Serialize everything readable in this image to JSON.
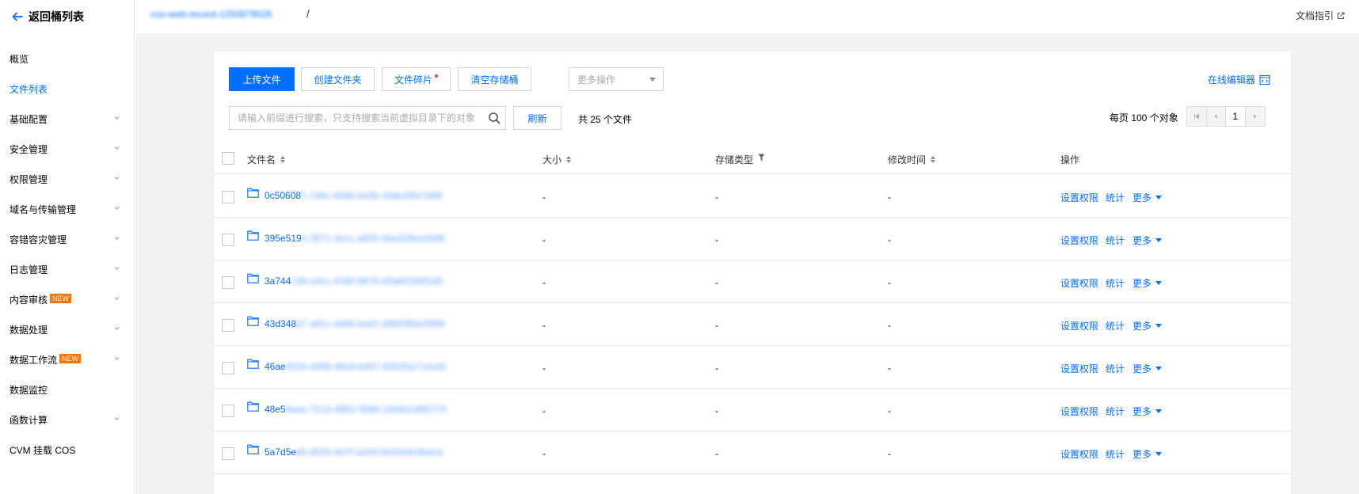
{
  "sidebar": {
    "back_label": "返回桶列表",
    "items": [
      {
        "label": "概览",
        "active": false,
        "expandable": false
      },
      {
        "label": "文件列表",
        "active": true,
        "expandable": false
      },
      {
        "label": "基础配置",
        "active": false,
        "expandable": true
      },
      {
        "label": "安全管理",
        "active": false,
        "expandable": true
      },
      {
        "label": "权限管理",
        "active": false,
        "expandable": true
      },
      {
        "label": "域名与传输管理",
        "active": false,
        "expandable": true
      },
      {
        "label": "容错容灾管理",
        "active": false,
        "expandable": true
      },
      {
        "label": "日志管理",
        "active": false,
        "expandable": true
      },
      {
        "label": "内容审核",
        "active": false,
        "expandable": true,
        "badge": "NEW"
      },
      {
        "label": "数据处理",
        "active": false,
        "expandable": true
      },
      {
        "label": "数据工作流",
        "active": false,
        "expandable": true,
        "badge": "NEW"
      },
      {
        "label": "数据监控",
        "active": false,
        "expandable": false
      },
      {
        "label": "函数计算",
        "active": false,
        "expandable": true
      },
      {
        "label": "CVM 挂载 COS",
        "active": false,
        "expandable": false
      }
    ]
  },
  "topbar": {
    "bucket_name": "cos-web-record-1250879026",
    "separator": "/",
    "doc_guide": "文档指引"
  },
  "toolbar": {
    "upload": "上传文件",
    "create_folder": "创建文件夹",
    "fragments": "文件碎片",
    "clear_bucket": "清空存储桶",
    "more_ops": "更多操作",
    "online_editor": "在线编辑器",
    "search_placeholder": "请输入前缀进行搜索，只支持搜索当前虚拟目录下的对象",
    "refresh": "刷新",
    "total": "共 25 个文件",
    "per_page": "每页 100 个对象",
    "page": "1"
  },
  "table": {
    "headers": {
      "name": "文件名",
      "size": "大小",
      "storage": "存储类型",
      "modified": "修改时间",
      "actions": "操作"
    },
    "action_labels": {
      "perm": "设置权限",
      "stats": "统计",
      "more": "更多"
    },
    "rows": [
      {
        "prefix": "0c50608",
        "hidden": "1-7d4c-40db-be3b-1fabc06e7d08",
        "size": "-",
        "storage": "-",
        "modified": "-"
      },
      {
        "prefix": "395e519",
        "hidden": "5-3571-4ccc-a605-5ba329ea24d6",
        "size": "-",
        "storage": "-",
        "modified": "-"
      },
      {
        "prefix": "3a744",
        "hidden": "136-a3cc-4180-8676-d3a80166f1d0",
        "size": "-",
        "storage": "-",
        "modified": "-"
      },
      {
        "prefix": "43d348",
        "hidden": "b7-a61c-4a86-bad1-d06595bc0996",
        "size": "-",
        "storage": "-",
        "modified": "-"
      },
      {
        "prefix": "46ae",
        "hidden": "9234-d088-46e6-b457-93025a714ca5",
        "size": "-",
        "storage": "-",
        "modified": "-"
      },
      {
        "prefix": "48e5",
        "hidden": "6aee-721d-4982-90d0-15d0a1985770",
        "size": "-",
        "storage": "-",
        "modified": "-"
      },
      {
        "prefix": "5a7d5e",
        "hidden": "b5-d020-4e7f-ae04-0e03e4c0bacd",
        "size": "-",
        "storage": "-",
        "modified": "-"
      }
    ]
  }
}
